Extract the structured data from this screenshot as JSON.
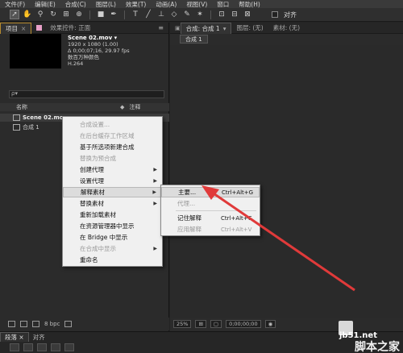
{
  "menubar": [
    "文件(F)",
    "编辑(E)",
    "合成(C)",
    "图层(L)",
    "效果(T)",
    "动画(A)",
    "视图(V)",
    "窗口",
    "帮助(H)"
  ],
  "toolbar": {
    "align_label": "对齐"
  },
  "project": {
    "tab_project": "项目",
    "tab_close": "×",
    "tab_effects": "效果控件: 正面",
    "menu_icon": "≡",
    "file_name": "Scene 02.mov ▾",
    "info_lines": [
      "1920 x 1080 (1.00)",
      "Δ 0;00;07;16, 29.97 fps",
      "数百万种颜色",
      "H.264"
    ],
    "search_icon": "ρ▾",
    "col_name": "名称",
    "col_note": "注释",
    "items": [
      {
        "name": "Scene 02.mov"
      },
      {
        "name": "合成 1"
      }
    ],
    "bpc_label": "8 bpc"
  },
  "comp": {
    "tab_label": "合成: 合成 1",
    "tab_dd": "▾",
    "tab_layer": "图层: (无)",
    "tab_footage": "素材: (无)",
    "sub_tab": "合成 1",
    "zoom": "25%",
    "timecode": "0;00;00;00"
  },
  "bottom": {
    "tab_para": "段落",
    "tab_close": "×",
    "tab_align": "对齐"
  },
  "context_menu": {
    "items": [
      {
        "label": "合成设置...",
        "disabled": true
      },
      {
        "label": "在后台缓存工作区域",
        "disabled": true
      },
      {
        "label": "基于所选项新建合成",
        "disabled": false
      },
      {
        "label": "替换为预合成",
        "disabled": true
      },
      {
        "label": "创建代理",
        "disabled": false,
        "submenu": true
      },
      {
        "label": "设置代理",
        "disabled": false,
        "submenu": true
      },
      {
        "label": "解释素材",
        "disabled": false,
        "submenu": true,
        "highlighted": true
      },
      {
        "label": "替换素材",
        "disabled": false,
        "submenu": true
      },
      {
        "label": "重新加载素材",
        "disabled": false
      },
      {
        "label": "在资源管理器中显示",
        "disabled": false
      },
      {
        "label": "在 Bridge 中显示",
        "disabled": false
      },
      {
        "label": "在合成中显示",
        "disabled": true,
        "submenu": true
      },
      {
        "label": "重命名",
        "disabled": false
      }
    ],
    "submenu_arrow": "▶"
  },
  "interpret_submenu": [
    {
      "label": "主要...",
      "shortcut": "Ctrl+Alt+G",
      "highlighted": true
    },
    {
      "label": "代理...",
      "shortcut": "",
      "disabled": true
    },
    {
      "label": "记住解释",
      "shortcut": "Ctrl+Alt+C"
    },
    {
      "label": "应用解释",
      "shortcut": "Ctrl+Alt+V",
      "disabled": true
    }
  ],
  "watermark": {
    "site": "jb51.net",
    "name": "脚本之家"
  },
  "colors": {
    "arrow": "#e03a3a",
    "panel_highlight": "#b58a2e"
  }
}
